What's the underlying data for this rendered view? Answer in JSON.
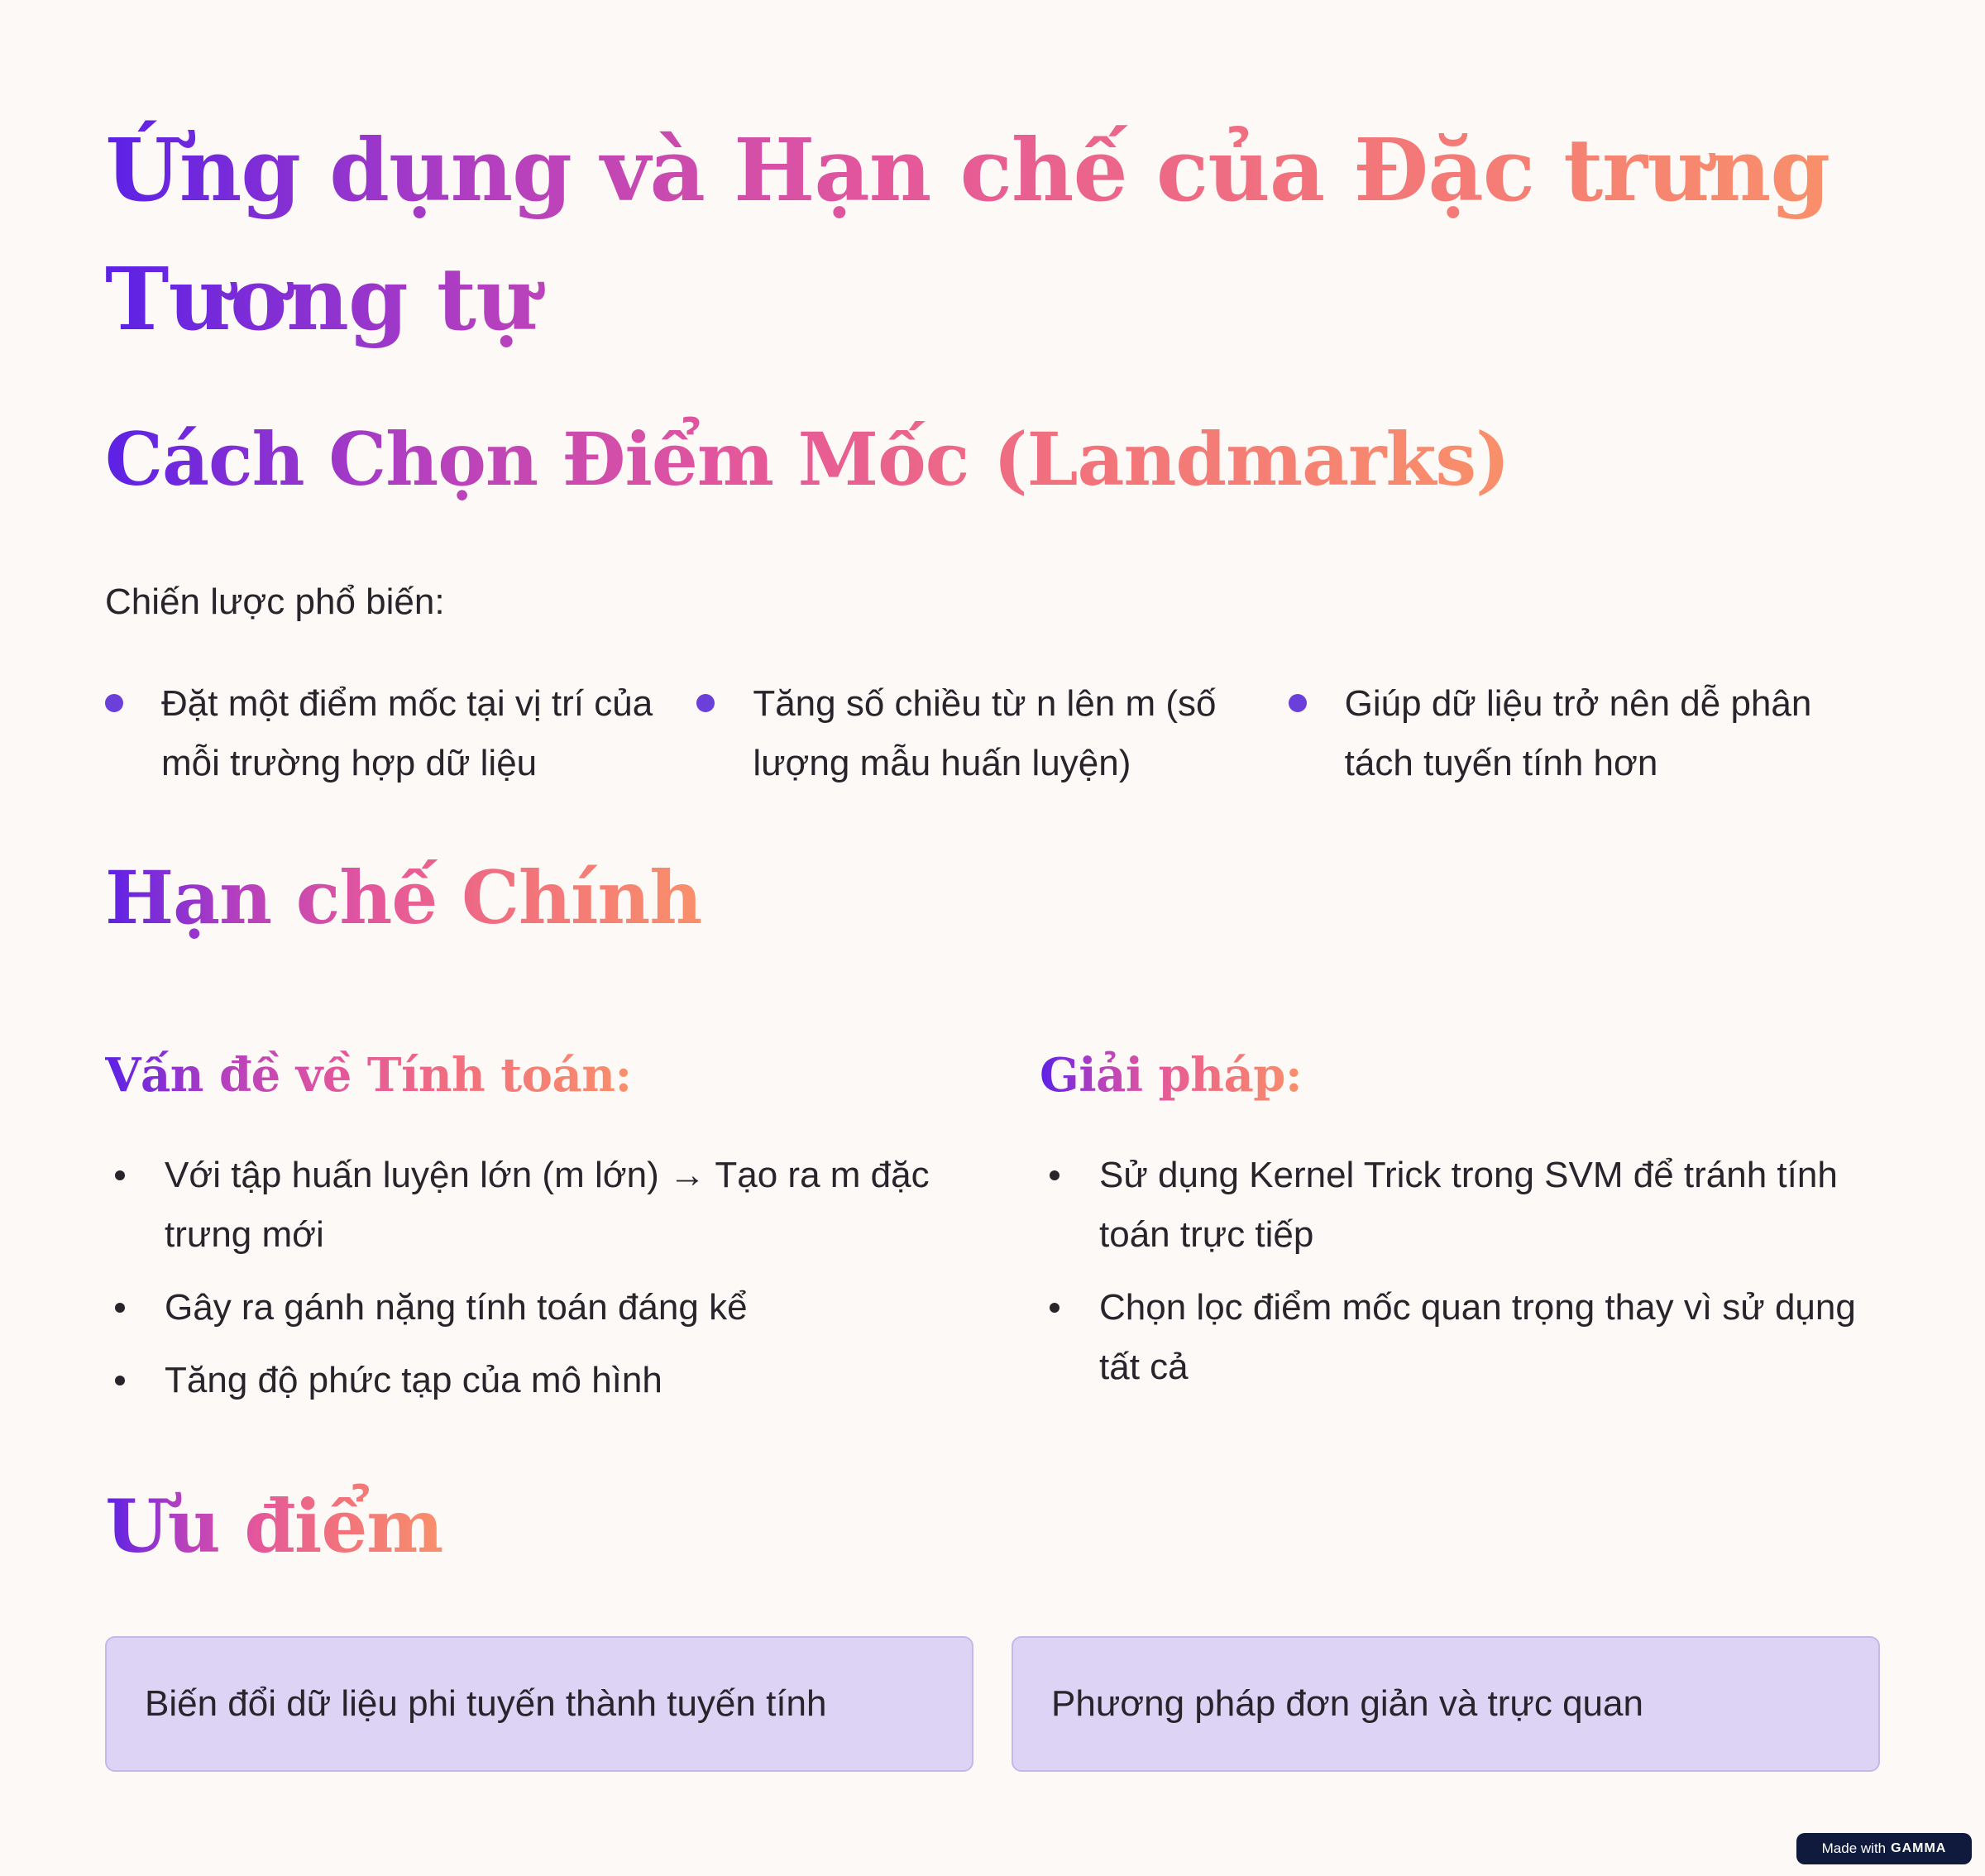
{
  "title": "Ứng dụng và Hạn chế của Đặc trưng Tương tự",
  "landmarks": {
    "heading": "Cách Chọn Điểm Mốc (Landmarks)",
    "lead": "Chiến lược phổ biến:",
    "items": [
      "Đặt một điểm mốc tại vị trí của mỗi trường hợp dữ liệu",
      "Tăng số chiều từ n lên m (số lượng mẫu huấn luyện)",
      "Giúp dữ liệu trở nên dễ phân tách tuyến tính hơn"
    ]
  },
  "limits": {
    "heading": "Hạn chế Chính",
    "compute": {
      "heading": "Vấn đề về Tính toán:",
      "items": [
        "Với tập huấn luyện lớn (m lớn) → Tạo ra m đặc trưng mới",
        "Gây ra gánh nặng tính toán đáng kể",
        "Tăng độ phức tạp của mô hình"
      ]
    },
    "solution": {
      "heading": "Giải pháp:",
      "items": [
        "Sử dụng Kernel Trick trong SVM để tránh tính toán trực tiếp",
        "Chọn lọc điểm mốc quan trọng thay vì sử dụng tất cả"
      ]
    }
  },
  "advantages": {
    "heading": "Ưu điểm",
    "cards": [
      "Biến đổi dữ liệu phi tuyến thành tuyến tính",
      "Phương pháp đơn giản và trực quan"
    ]
  },
  "badge": {
    "prefix": "Made with",
    "brand": "GAMMA"
  },
  "colors": {
    "gradient_start": "#5b21e6",
    "gradient_end": "#f9906a",
    "card_bg": "#ddd3f4",
    "bullet_accent": "#6b3fd9",
    "page_bg": "#fdf9f6"
  }
}
